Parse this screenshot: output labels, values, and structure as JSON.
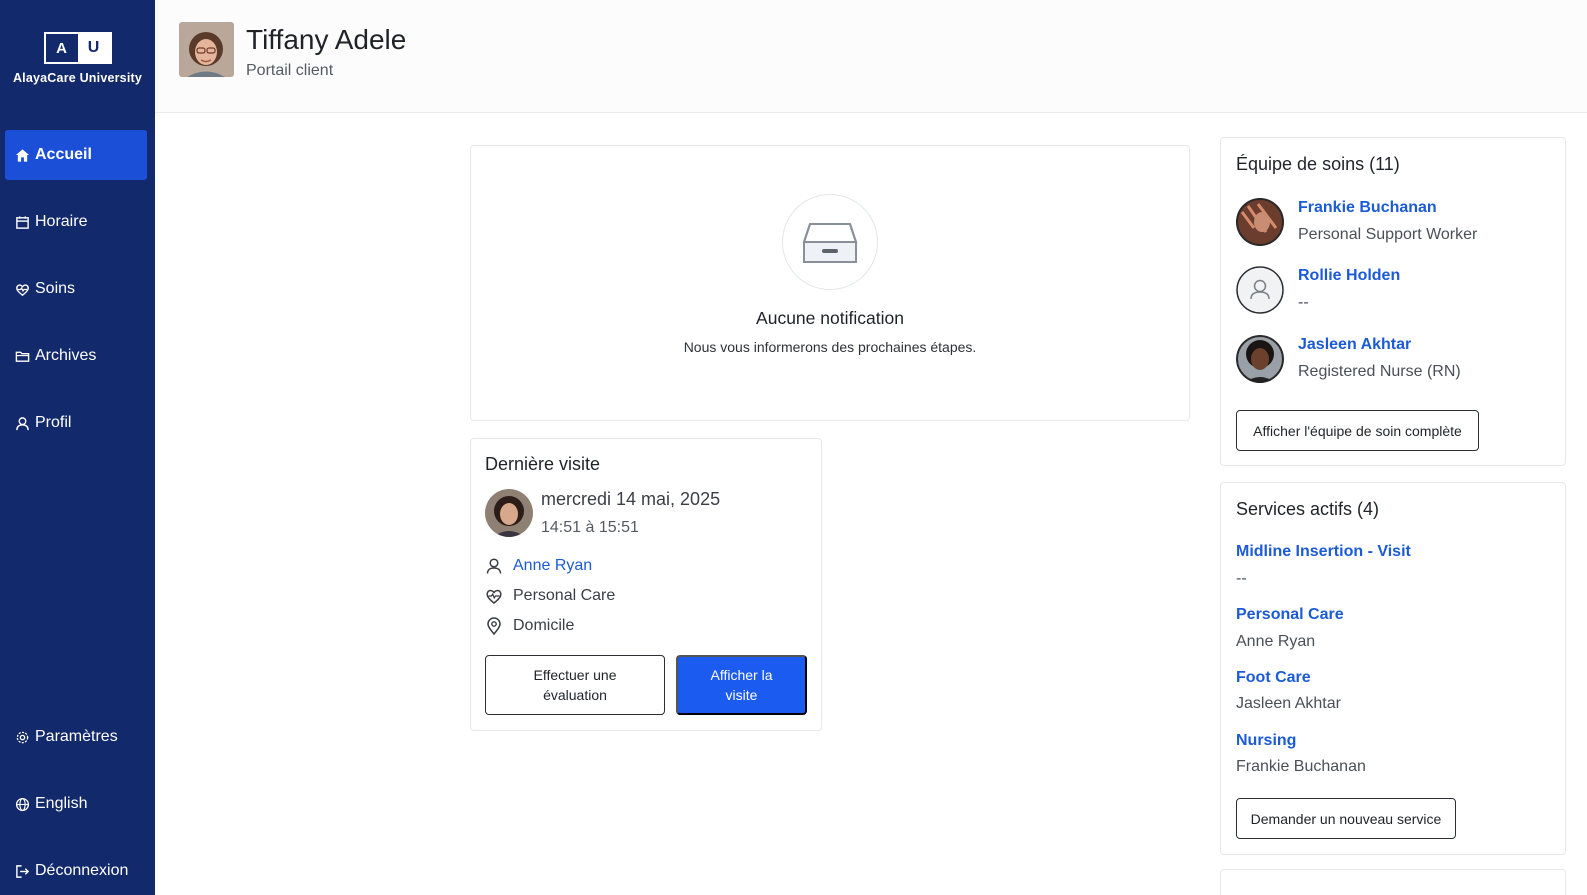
{
  "sidebar": {
    "logo_left": "A",
    "logo_right": "U",
    "brand": "AlayaCare University",
    "nav": [
      {
        "label": "Accueil",
        "icon": "home-icon",
        "active": true
      },
      {
        "label": "Horaire",
        "icon": "calendar-icon"
      },
      {
        "label": "Soins",
        "icon": "heart-pulse-icon"
      },
      {
        "label": "Archives",
        "icon": "folder-icon"
      },
      {
        "label": "Profil",
        "icon": "user-icon"
      }
    ],
    "bottom_nav": [
      {
        "label": "Paramètres",
        "icon": "gear-icon"
      },
      {
        "label": "English",
        "icon": "globe-icon"
      },
      {
        "label": "Déconnexion",
        "icon": "logout-icon"
      }
    ]
  },
  "header": {
    "name": "Tiffany Adele",
    "subtitle": "Portail client"
  },
  "notifications": {
    "title": "Aucune notification",
    "description": "Nous vous informerons des prochaines étapes."
  },
  "last_visit": {
    "title": "Dernière visite",
    "date": "mercredi 14 mai, 2025",
    "time": "14:51 à 15:51",
    "caregiver": "Anne Ryan",
    "service": "Personal Care",
    "location": "Domicile",
    "evaluate_label": "Effectuer une évaluation",
    "view_label": "Afficher la visite"
  },
  "care_team": {
    "title": "Équipe de soins (11)",
    "members": [
      {
        "name": "Frankie Buchanan",
        "role": "Personal Support Worker"
      },
      {
        "name": "Rollie Holden",
        "role": "--"
      },
      {
        "name": "Jasleen Akhtar",
        "role": "Registered Nurse (RN)"
      }
    ],
    "view_all_label": "Afficher l'équipe de soin complète"
  },
  "services": {
    "title": "Services actifs (4)",
    "items": [
      {
        "name": "Midline Insertion - Visit",
        "sub": "--"
      },
      {
        "name": "Personal Care",
        "sub": "Anne Ryan"
      },
      {
        "name": "Foot Care",
        "sub": "Jasleen Akhtar"
      },
      {
        "name": "Nursing",
        "sub": "Frankie Buchanan"
      }
    ],
    "request_label": "Demander un nouveau service"
  }
}
